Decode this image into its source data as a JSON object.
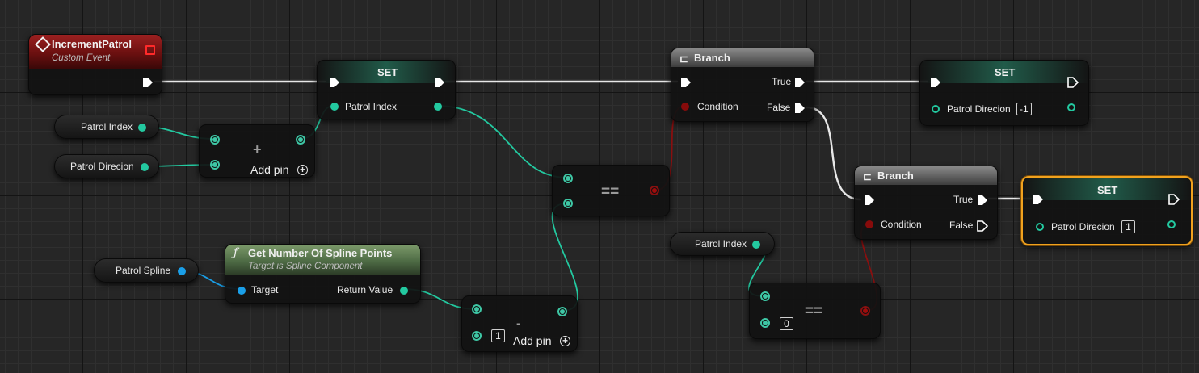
{
  "graph": {
    "custom_event": {
      "title": "IncrementPatrol",
      "subtitle": "Custom Event"
    },
    "set_patrol_index": {
      "title": "SET",
      "pin": "Patrol Index"
    },
    "add_node": {
      "operator": "+",
      "add_pin": "Add pin"
    },
    "var_patrol_index": "Patrol Index",
    "var_patrol_direcion": "Patrol Direcion",
    "branch_1": {
      "title": "Branch",
      "condition": "Condition",
      "true": "True",
      "false": "False"
    },
    "set_direcion_neg": {
      "title": "SET",
      "pin": "Patrol Direcion",
      "value": "-1"
    },
    "equal_node_1": {
      "operator": "=="
    },
    "branch_2": {
      "title": "Branch",
      "condition": "Condition",
      "true": "True",
      "false": "False"
    },
    "set_direcion_pos": {
      "title": "SET",
      "pin": "Patrol Direcion",
      "value": "1"
    },
    "var_patrol_spline": "Patrol Spline",
    "get_spline_points": {
      "title": "Get Number Of Spline Points",
      "subtitle": "Target is Spline Component",
      "target": "Target",
      "return_value": "Return Value"
    },
    "subtract_node": {
      "operator": "-",
      "value": "1",
      "add_pin": "Add pin"
    },
    "var_patrol_index_2": "Patrol Index",
    "equal_node_2": {
      "operator": "==",
      "value": "0"
    }
  },
  "colors": {
    "exec": "#ffffff",
    "integer": "#23c9a0",
    "boolean": "#870b0b",
    "object": "#1a9fe8",
    "selected": "#f1a21e",
    "event_header": "#8e1b1b"
  }
}
